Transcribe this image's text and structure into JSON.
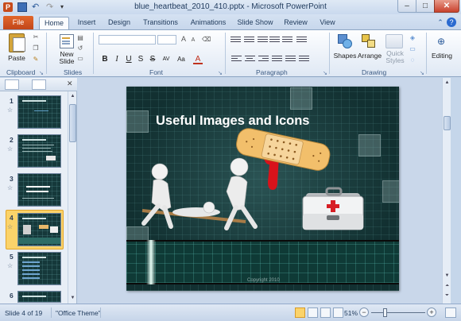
{
  "window": {
    "title": "blue_heartbeat_2010_410.pptx - Microsoft PowerPoint",
    "app_logo_letter": "P",
    "minimize": "–",
    "maximize": "□",
    "close": "✕"
  },
  "quick_access": {
    "undo": "↶",
    "redo": "↷",
    "more": "▾"
  },
  "tabs": {
    "file": "File",
    "items": [
      "Home",
      "Insert",
      "Design",
      "Transitions",
      "Animations",
      "Slide Show",
      "Review",
      "View"
    ],
    "active": "Home",
    "help": "?"
  },
  "ribbon": {
    "clipboard": {
      "label": "Clipboard",
      "paste": "Paste"
    },
    "slides": {
      "label": "Slides",
      "new_slide": "New\nSlide",
      "new_slide_arrow": "▾"
    },
    "font": {
      "label": "Font",
      "bold": "B",
      "italic": "I",
      "underline": "U",
      "strike": "S",
      "shadow": "abc",
      "spacing": "AV",
      "case": "Aa",
      "color": "A"
    },
    "paragraph": {
      "label": "Paragraph"
    },
    "drawing": {
      "label": "Drawing",
      "shapes": "Shapes",
      "arrange": "Arrange",
      "quick_styles": "Quick\nStyles"
    },
    "editing": {
      "label": "Editing"
    }
  },
  "thumbnails": {
    "items": [
      {
        "number": "1"
      },
      {
        "number": "2"
      },
      {
        "number": "3"
      },
      {
        "number": "4",
        "selected": true
      },
      {
        "number": "5"
      },
      {
        "number": "6"
      }
    ]
  },
  "slide": {
    "title": "Useful Images and Icons",
    "footer": "Copyright 2010"
  },
  "status": {
    "slide_info": "Slide 4 of 19",
    "theme": "\"Office Theme\"",
    "zoom": "51%",
    "zoom_fraction": 0.51
  },
  "colors": {
    "file_tab": "#c2461a",
    "selection": "#fbd36a",
    "slide_bg": "#133133"
  }
}
